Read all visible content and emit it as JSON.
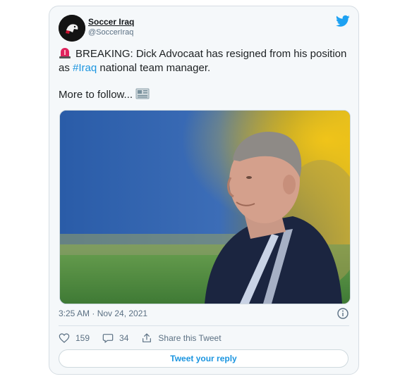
{
  "author": {
    "name": "Soccer Iraq",
    "handle": "@SoccerIraq"
  },
  "icons": {
    "brand": "twitter-bird-icon",
    "emoji_1": "police-siren-icon",
    "emoji_2": "newspaper-icon",
    "like": "heart-icon",
    "reply": "speech-bubble-icon",
    "share": "share-upload-icon",
    "info": "info-icon"
  },
  "tweet": {
    "line1_prefix": "BREAKING: Dick Advocaat has resigned from his position as ",
    "hashtag": "#Iraq",
    "line1_suffix": " national team manager.",
    "line2": "More to follow..."
  },
  "meta": {
    "timestamp": "3:25 AM · Nov 24, 2021"
  },
  "actions": {
    "likes": "159",
    "replies": "34",
    "share_label": "Share this Tweet",
    "reply_button": "Tweet your reply"
  },
  "colors": {
    "twitter_blue": "#1da1f2",
    "link_blue": "#1b95e0",
    "card_bg": "#f5f8fa",
    "muted_text": "#5b7083"
  }
}
